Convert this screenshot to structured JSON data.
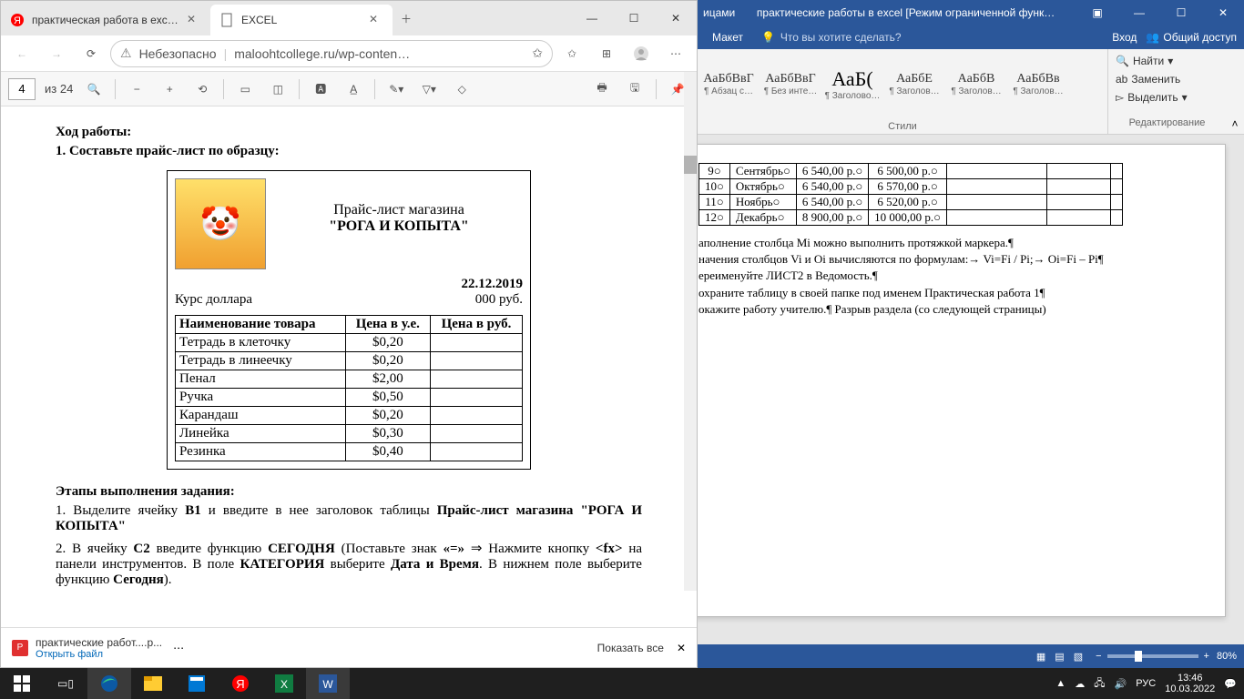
{
  "browser": {
    "tabs": [
      {
        "title": "практическая работа в excel —",
        "favicon": "yandex"
      },
      {
        "title": "EXCEL",
        "favicon": "pdf",
        "active": true
      }
    ],
    "addr_warning": "Небезопасно",
    "url": "maloohtcollege.ru/wp-conten…",
    "pdf": {
      "page": "4",
      "total": "из 24"
    },
    "doc": {
      "heading": "Ход работы:",
      "step1": "1.  Составьте прайс-лист по образцу:",
      "price_title1": "Прайс-лист магазина",
      "price_title2": "\"РОГА И КОПЫТА\"",
      "date": "22.12.2019",
      "kurs": "Курс доллара",
      "rub": "000 руб.",
      "th1": "Наименование товара",
      "th2": "Цена в у.е.",
      "th3": "Цена в руб.",
      "rows": [
        {
          "n": "Тетрадь в клеточку",
          "p": "$0,20"
        },
        {
          "n": "Тетрадь в линеечку",
          "p": "$0,20"
        },
        {
          "n": "Пенал",
          "p": "$2,00"
        },
        {
          "n": "Ручка",
          "p": "$0,50"
        },
        {
          "n": "Карандаш",
          "p": "$0,20"
        },
        {
          "n": "Линейка",
          "p": "$0,30"
        },
        {
          "n": "Резинка",
          "p": "$0,40"
        }
      ],
      "steps_h": "Этапы выполнения задания:",
      "s1a": "1.  Выделите ячейку ",
      "s1b": "B1",
      "s1c": " и введите в нее заголовок таблицы ",
      "s1d": "Прайс-лист магазина \"РОГА И КОПЫТА\"",
      "s2a": "2.  В ячейку ",
      "s2b": "C2",
      "s2c": " введите функцию ",
      "s2d": "СЕГОДНЯ",
      "s2e": " (Поставьте знак ",
      "s2f": "«=»",
      "s2g": "  Нажмите кнопку ",
      "s2h": "<fx>",
      "s2i": " на панели инструментов. В поле ",
      "s2j": "КАТЕГОРИЯ",
      "s2k": " выберите ",
      "s2l": "Дата и Время",
      "s2m": ". В нижнем поле выберите функцию ",
      "s2n": "Сегодня",
      "s2o": ")."
    },
    "download": {
      "name": "практические работ....р...",
      "open": "Открыть файл",
      "showall": "Показать все"
    }
  },
  "word": {
    "title_left": "ицами",
    "doc_title": "практические работы в excel [Режим ограниченной функ…",
    "tab_maket": "Макет",
    "tell": "Что вы хотите сделать?",
    "login": "Вход",
    "share": "Общий доступ",
    "styles": [
      "¶ Абзац с…",
      "¶ Без инте…",
      "¶ Заголово…",
      "¶ Заголов…",
      "¶ Заголов…",
      "¶ Заголов…"
    ],
    "styles_preview": [
      "АаБбВвГ",
      "АаБбВвГ",
      "АаБ(",
      "АаБбЕ",
      "АаБбВ",
      "АаБбВв"
    ],
    "group_styles": "Стили",
    "find": "Найти",
    "replace": "Заменить",
    "select": "Выделить",
    "group_edit": "Редактирование",
    "table": [
      {
        "n": "9",
        "m": "Сентябрь",
        "a": "6 540,00 р.",
        "b": "6 500,00 р."
      },
      {
        "n": "10",
        "m": "Октябрь",
        "a": "6 540,00 р.",
        "b": "6 570,00 р."
      },
      {
        "n": "11",
        "m": "Ноябрь",
        "a": "6 540,00 р.",
        "b": "6 520,00 р."
      },
      {
        "n": "12",
        "m": "Декабрь",
        "a": "8 900,00 р.",
        "b": "10 000,00 р."
      }
    ],
    "body": [
      "аполнение столбца Mi можно выполнить протяжкой маркера.¶",
      "начения столбцов Vi и Oi вычисляются по формулам:→ Vi=Fi / Pi;→ Oi=Fi – Pi¶",
      "ереименуйте ЛИСТ2 в Ведомость.¶",
      "охраните таблицу в своей папке под именем Практическая работа 1¶",
      "окажите работу учителю.¶                          Разрыв раздела (со следующей страницы)"
    ],
    "zoom": "80%"
  },
  "taskbar": {
    "lang": "РУС",
    "time": "13:46",
    "date": "10.03.2022"
  }
}
